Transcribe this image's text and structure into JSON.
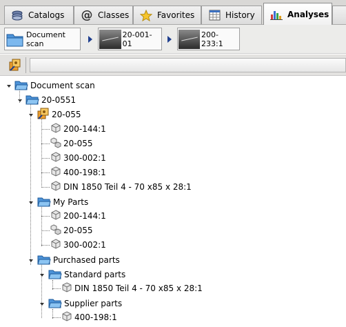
{
  "tabs": [
    {
      "label": "Catalogs",
      "icon": "catalogs-icon"
    },
    {
      "label": "Classes",
      "icon": "at-sign-icon"
    },
    {
      "label": "Favorites",
      "icon": "star-icon"
    },
    {
      "label": "History",
      "icon": "calendar-icon"
    },
    {
      "label": "Analyses",
      "icon": "bar-chart-icon",
      "active": true
    }
  ],
  "breadcrumb": [
    {
      "label": "Document scan",
      "icon": "folder-icon"
    },
    {
      "label": "20-001-01",
      "icon": "thumbnail"
    },
    {
      "label": "200-233:1",
      "icon": "thumbnail"
    }
  ],
  "tree": {
    "root": "Document scan",
    "group": "20-0551",
    "assembly": "20-055",
    "assembly_children": [
      "200-144:1",
      "20-055",
      "300-002:1",
      "400-198:1",
      "DIN 1850 Teil 4 - 70 x85 x 28:1"
    ],
    "my_parts": "My Parts",
    "my_parts_children": [
      "200-144:1",
      "20-055",
      "300-002:1"
    ],
    "purchased": "Purchased parts",
    "standard": "Standard parts",
    "standard_children": [
      "DIN 1850 Teil 4 - 70 x85 x 28:1"
    ],
    "supplier": "Supplier parts",
    "supplier_children": [
      "400-198:1"
    ]
  },
  "colors": {
    "accent": "#1f3f8f",
    "folder": "#5aa0e0"
  }
}
